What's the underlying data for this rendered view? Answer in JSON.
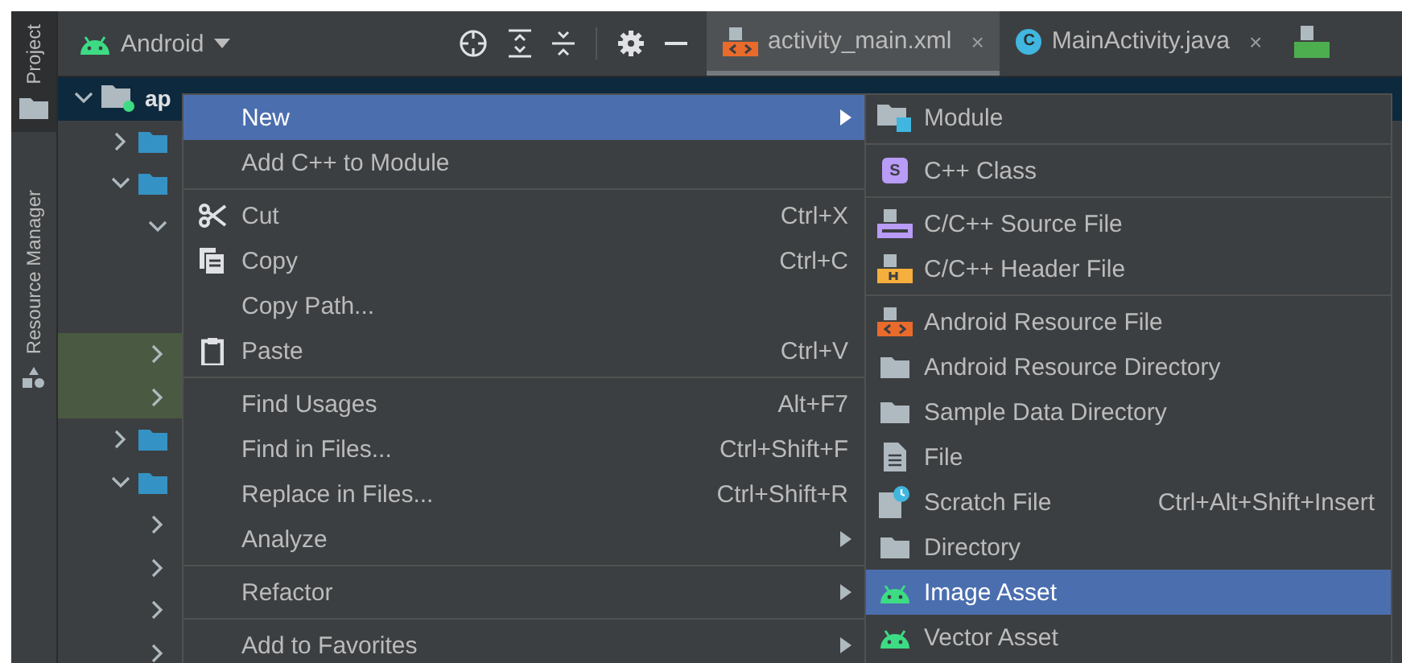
{
  "sidebar": {
    "tabs": [
      {
        "label": "Project",
        "selected": true
      },
      {
        "label": "Resource Manager",
        "selected": false
      }
    ]
  },
  "project_view": {
    "selector": "Android"
  },
  "editor_tabs": [
    {
      "kind": "xml",
      "label": "activity_main.xml",
      "close": "×",
      "selected": true
    },
    {
      "kind": "class",
      "badge": "C",
      "label": "MainActivity.java",
      "close": "×",
      "selected": false
    },
    {
      "kind": "manifest",
      "selected": false
    }
  ],
  "tree": [
    {
      "label": "ap",
      "expanded": true,
      "selected": true,
      "children": [
        {
          "expanded": false
        },
        {
          "expanded": true,
          "children": [
            {
              "expanded": true
            },
            {
              "expanded": false,
              "highlighted": true
            },
            {
              "expanded": false,
              "highlighted": true
            }
          ]
        },
        {
          "expanded": false
        },
        {
          "expanded": true,
          "children": [
            {
              "expanded": false
            },
            {
              "expanded": false
            },
            {
              "expanded": false
            },
            {
              "expanded": false
            }
          ]
        }
      ]
    }
  ],
  "context_menu": {
    "items": [
      {
        "kind": "text",
        "label": "New",
        "submenu": true,
        "selected": true
      },
      {
        "kind": "text",
        "label": "Add C++ to Module",
        "selected": false
      },
      {
        "kind": "separator"
      },
      {
        "kind": "scissors",
        "label": "Cut",
        "shortcut": "Ctrl+X",
        "selected": false
      },
      {
        "kind": "copy",
        "label": "Copy",
        "shortcut": "Ctrl+C",
        "selected": false
      },
      {
        "kind": "text",
        "label": "Copy Path...",
        "selected": false
      },
      {
        "kind": "clipboard",
        "label": "Paste",
        "shortcut": "Ctrl+V",
        "selected": false
      },
      {
        "kind": "separator"
      },
      {
        "kind": "text",
        "label": "Find Usages",
        "shortcut": "Alt+F7",
        "selected": false
      },
      {
        "kind": "text",
        "label": "Find in Files...",
        "shortcut": "Ctrl+Shift+F",
        "selected": false
      },
      {
        "kind": "text",
        "label": "Replace in Files...",
        "shortcut": "Ctrl+Shift+R",
        "selected": false
      },
      {
        "kind": "text",
        "label": "Analyze",
        "submenu": true,
        "selected": false
      },
      {
        "kind": "separator"
      },
      {
        "kind": "text",
        "label": "Refactor",
        "submenu": true,
        "selected": false
      },
      {
        "kind": "separator"
      },
      {
        "kind": "text",
        "label": "Add to Favorites",
        "submenu": true,
        "selected": false
      }
    ]
  },
  "new_submenu": {
    "items": [
      {
        "kind": "module",
        "label": "Module",
        "selected": false
      },
      {
        "kind": "separator"
      },
      {
        "kind": "class",
        "badge": "S",
        "label": "C++ Class",
        "selected": false
      },
      {
        "kind": "separator"
      },
      {
        "kind": "source",
        "label": "C/C++ Source File",
        "selected": false
      },
      {
        "kind": "header",
        "label": "C/C++ Header File",
        "selected": false
      },
      {
        "kind": "separator"
      },
      {
        "kind": "xml",
        "label": "Android Resource File",
        "selected": false
      },
      {
        "kind": "folder",
        "label": "Android Resource Directory",
        "selected": false
      },
      {
        "kind": "folder",
        "label": "Sample Data Directory",
        "selected": false
      },
      {
        "kind": "file",
        "label": "File",
        "selected": false
      },
      {
        "kind": "scratch",
        "label": "Scratch File",
        "shortcut": "Ctrl+Alt+Shift+Insert",
        "selected": false
      },
      {
        "kind": "folder",
        "label": "Directory",
        "selected": false
      },
      {
        "kind": "android",
        "label": "Image Asset",
        "selected": true
      },
      {
        "kind": "android",
        "label": "Vector Asset",
        "selected": false
      }
    ]
  }
}
